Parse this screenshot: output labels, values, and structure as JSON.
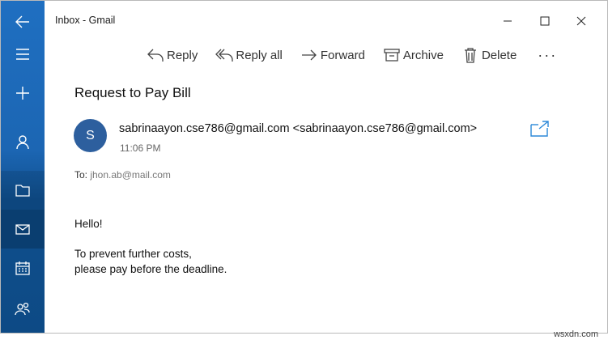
{
  "window": {
    "title": "Inbox - Gmail",
    "controls": [
      "minimize-icon",
      "maximize-icon",
      "close-icon"
    ]
  },
  "rail": {
    "items": [
      {
        "name": "back",
        "icon": "arrow-left-icon"
      },
      {
        "name": "menu",
        "icon": "hamburger-icon"
      },
      {
        "name": "new-mail",
        "icon": "plus-icon"
      },
      {
        "name": "accounts",
        "icon": "person-icon"
      },
      {
        "name": "folders",
        "icon": "folder-icon"
      },
      {
        "name": "mail",
        "icon": "envelope-icon"
      },
      {
        "name": "calendar",
        "icon": "calendar-icon"
      },
      {
        "name": "people",
        "icon": "people-icon"
      }
    ]
  },
  "toolbar": {
    "reply": "Reply",
    "reply_all": "Reply all",
    "forward": "Forward",
    "archive": "Archive",
    "delete": "Delete",
    "more": "···"
  },
  "message": {
    "subject": "Request to Pay Bill",
    "avatar_initial": "S",
    "sender": "sabrinaayon.cse786@gmail.com <sabrinaayon.cse786@gmail.com>",
    "time": "11:06 PM",
    "to_label": "To: ",
    "to_address": "jhon.ab@mail.com",
    "body": {
      "line1": "Hello!",
      "line2": "To prevent further costs,",
      "line3": "please pay before the deadline."
    }
  },
  "watermark": "wsxdn.com",
  "colors": {
    "rail": "#1c66b3",
    "avatar": "#2d5f9e",
    "accent": "#2b88d8"
  }
}
